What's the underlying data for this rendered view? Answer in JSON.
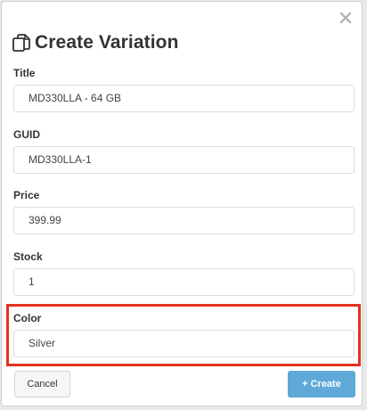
{
  "dialog": {
    "title": "Create Variation",
    "title_icon": "copy-icon",
    "close_icon": "close-icon"
  },
  "fields": {
    "title": {
      "label": "Title",
      "value": "MD330LLA - 64 GB"
    },
    "guid": {
      "label": "GUID",
      "value": "MD330LLA-1"
    },
    "price": {
      "label": "Price",
      "value": "399.99"
    },
    "stock": {
      "label": "Stock",
      "value": "1"
    },
    "color": {
      "label": "Color",
      "value": "Silver"
    }
  },
  "buttons": {
    "cancel_label": "Cancel",
    "create_label": "Create",
    "create_icon": "plus-icon"
  },
  "colors": {
    "create_button": "#5ea9d8",
    "highlight": "#e4321f"
  }
}
